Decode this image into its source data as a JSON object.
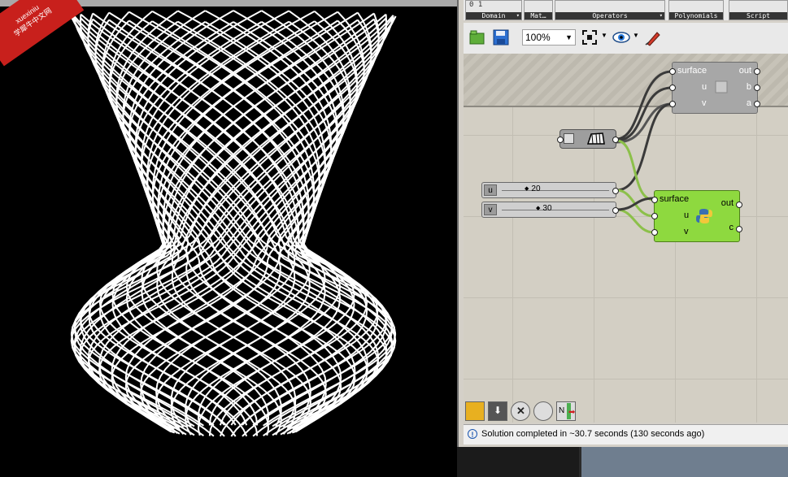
{
  "watermark": {
    "line1": "xuexiniu",
    "line2": "学犀牛中文网"
  },
  "ribbon": {
    "groups": [
      {
        "label": "Domain",
        "icons": "0 1",
        "has_arrow": true
      },
      {
        "label": "Mat…",
        "icons": "",
        "has_arrow": false
      },
      {
        "label": "Operators",
        "icons": "",
        "has_arrow": true
      },
      {
        "label": "Polynomials",
        "icons": "",
        "has_arrow": false
      },
      {
        "label": "Script",
        "icons": "",
        "has_arrow": false
      }
    ]
  },
  "toolbar": {
    "open_icon": "open-folder-icon",
    "save_icon": "save-disk-icon",
    "zoom_value": "100%",
    "zoom_extents_icon": "zoom-extents-icon",
    "preview_icon": "eye-preview-icon",
    "sketch_icon": "pen-sketch-icon"
  },
  "components": {
    "gray": {
      "inputs": [
        "surface",
        "u",
        "v"
      ],
      "outputs": [
        "out",
        "b",
        "a"
      ]
    },
    "python": {
      "inputs": [
        "surface",
        "u",
        "v"
      ],
      "outputs": [
        "out",
        "c"
      ],
      "color": "#8ed93f"
    },
    "surface_param_icon": "surface-param-icon",
    "sliders": [
      {
        "name": "u",
        "value": "20"
      },
      {
        "name": "v",
        "value": "30"
      }
    ]
  },
  "bottom_buttons": [
    "preview-filter-icon",
    "bake-icon",
    "disable-icon",
    "wire-display-icon",
    "solver-icon"
  ],
  "status": {
    "text": "Solution completed in ~30.7 seconds (130 seconds ago)"
  },
  "colors": {
    "viewport_bg": "#000000",
    "lattice": "#ffffff",
    "canvas_bg": "#d3cfc4",
    "wire_dark": "#3a3a3a",
    "wire_green": "#8cc04a"
  }
}
